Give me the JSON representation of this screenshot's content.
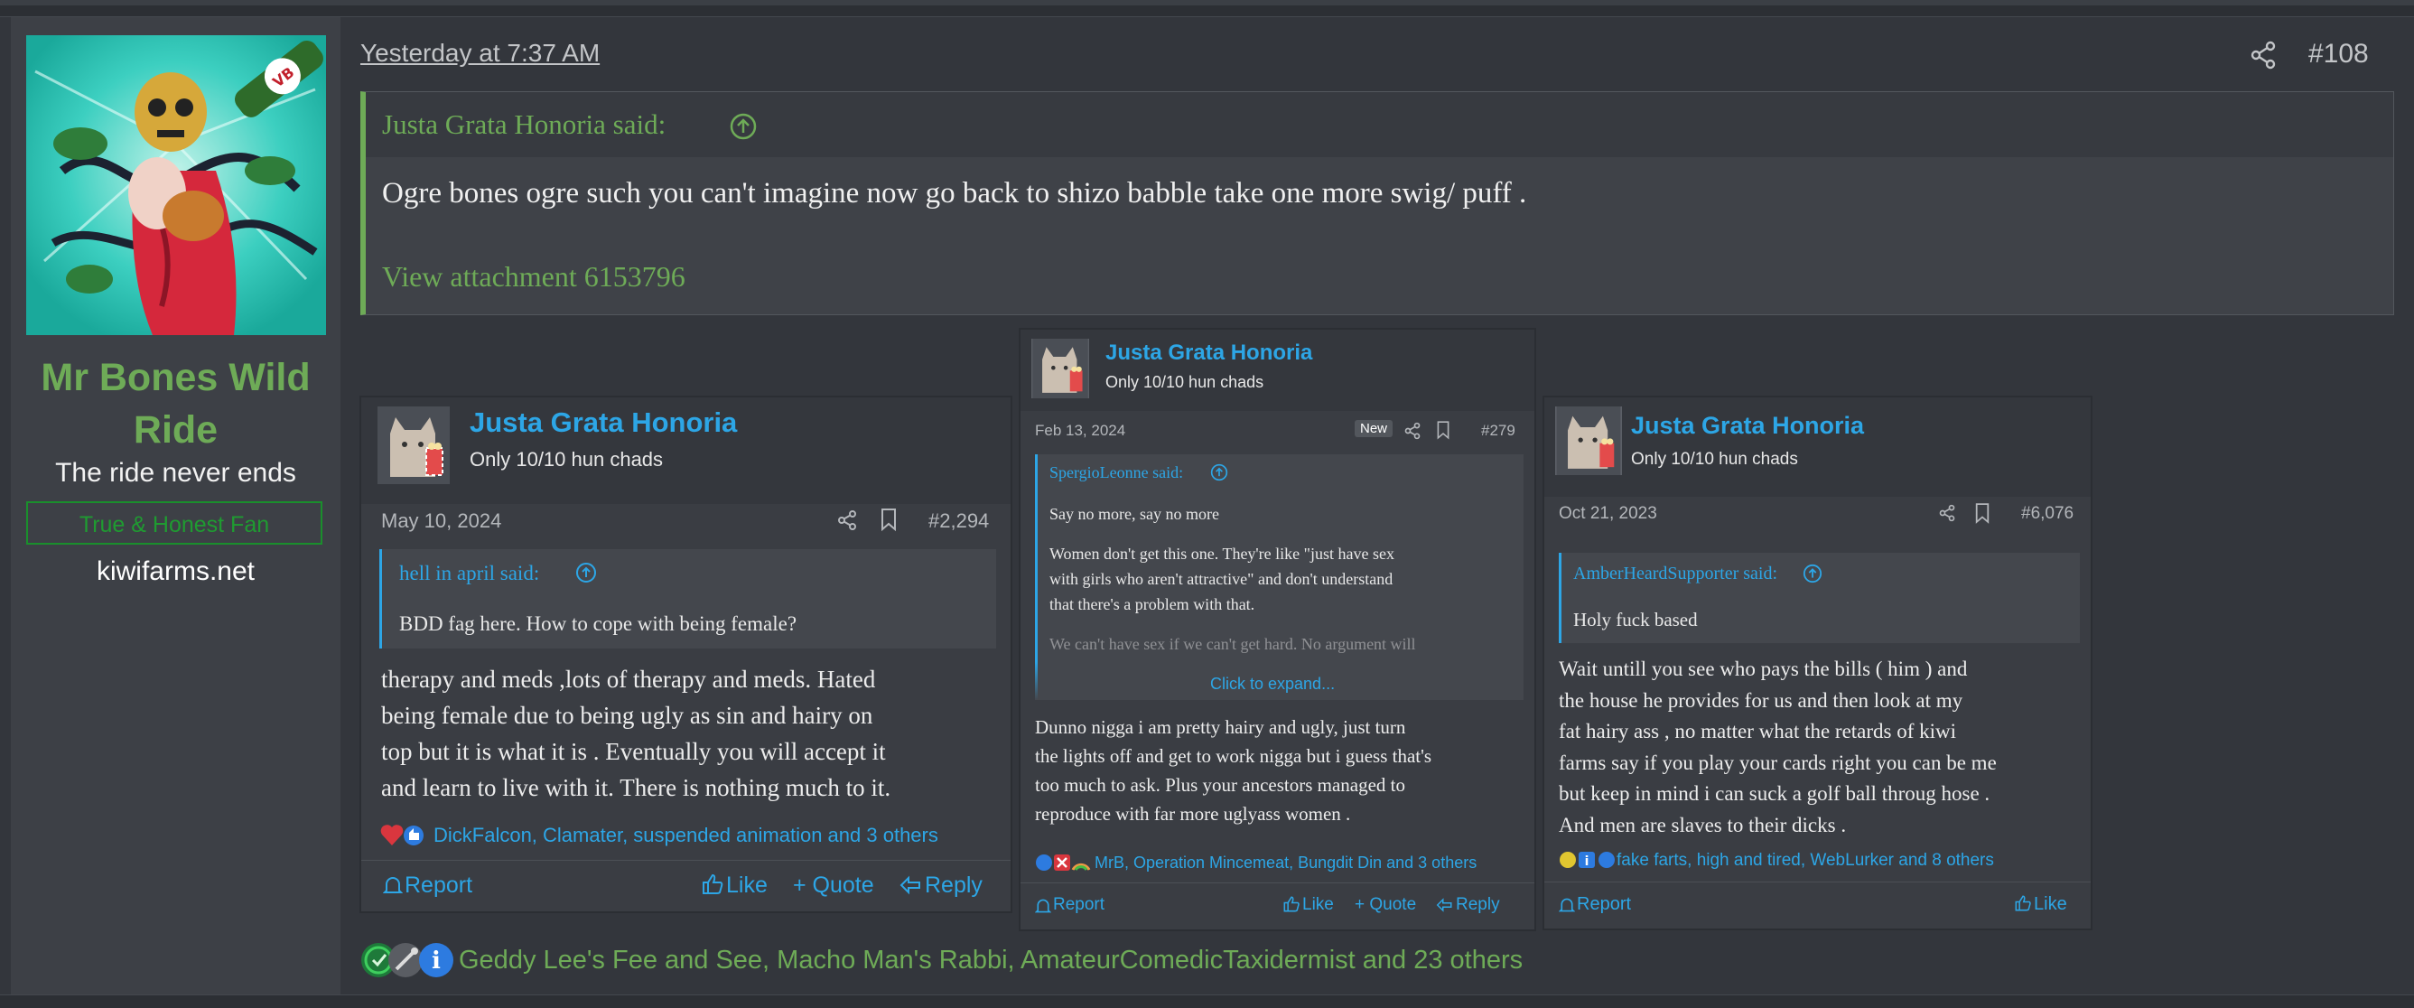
{
  "post": {
    "date": "Yesterday at 7:37 AM",
    "number": "#108",
    "author": {
      "name": "Mr Bones Wild Ride",
      "title": "The ride never ends",
      "banner": "True & Honest Fan",
      "site": "kiwifarms.net"
    },
    "quote": {
      "author": "Justa Grata Honoria said:",
      "text": "Ogre bones ogre such you can't imagine now go back to shizo babble take one more swig/ puff .",
      "attachment": "View attachment 6153796"
    },
    "reactions_text": "Geddy Lee's Fee and See, Macho Man's Rabbi, AmateurComedicTaxidermist and 23 others"
  },
  "attachments": [
    {
      "name": "Justa Grata Honoria",
      "user_title": "Only 10/10 hun chads",
      "date": "May 10, 2024",
      "number": "#2,294",
      "quote_author": "hell in april said:",
      "quote_text": "BDD fag here. How to cope with being female?",
      "body": [
        "therapy and meds ,lots of therapy and meds. Hated",
        "being female due to being ugly as sin and hairy on",
        "top but it is what it is . Eventually you will accept it",
        "and learn to live with it. There is nothing much to it."
      ],
      "reactions": "DickFalcon, Clamater, suspended animation and 3 others",
      "report": "Report",
      "like": "Like",
      "quote": "+ Quote",
      "reply": "Reply"
    },
    {
      "name": "Justa Grata Honoria",
      "user_title": "Only 10/10 hun chads",
      "date": "Feb 13, 2024",
      "badge": "New",
      "number": "#279",
      "quote_author": "SpergioLeonne said:",
      "quote_lines": [
        "Say no more, say no more",
        "",
        "Women don't get this one. They're like \"just have sex",
        "with girls who aren't attractive\" and don't understand",
        "that there's a problem with that.",
        "",
        "We can't have sex if we can't get hard. No argument will"
      ],
      "expand": "Click to expand...",
      "body": [
        "Dunno nigga i am pretty hairy and ugly, just turn",
        "the lights off and get to work nigga but i guess that's",
        "too much to ask. Plus your ancestors managed to",
        "reproduce with far more uglyass women ."
      ],
      "reactions": "MrB, Operation Mincemeat, Bungdit Din and 3 others",
      "report": "Report",
      "like": "Like",
      "quote": "+ Quote",
      "reply": "Reply"
    },
    {
      "name": "Justa Grata Honoria",
      "user_title": "Only 10/10 hun chads",
      "date": "Oct 21, 2023",
      "number": "#6,076",
      "quote_author": "AmberHeardSupporter said:",
      "quote_text": "Holy fuck based",
      "body": [
        "Wait untill you see who pays the bills ( him ) and",
        "the house he provides for us and then look at my",
        "fat hairy ass , no matter what the retards of kiwi",
        "farms say if you play your cards right you can be me",
        "but keep in mind i can suck a golf ball throug hose .",
        "And men are slaves to their dicks ."
      ],
      "reactions": "fake farts, high and tired, WebLurker and 8 others",
      "report": "Report",
      "like": "Like"
    }
  ],
  "colors": {
    "accent_green": "#6eab57",
    "link_blue": "#2da6e6",
    "bg": "#33363c"
  }
}
